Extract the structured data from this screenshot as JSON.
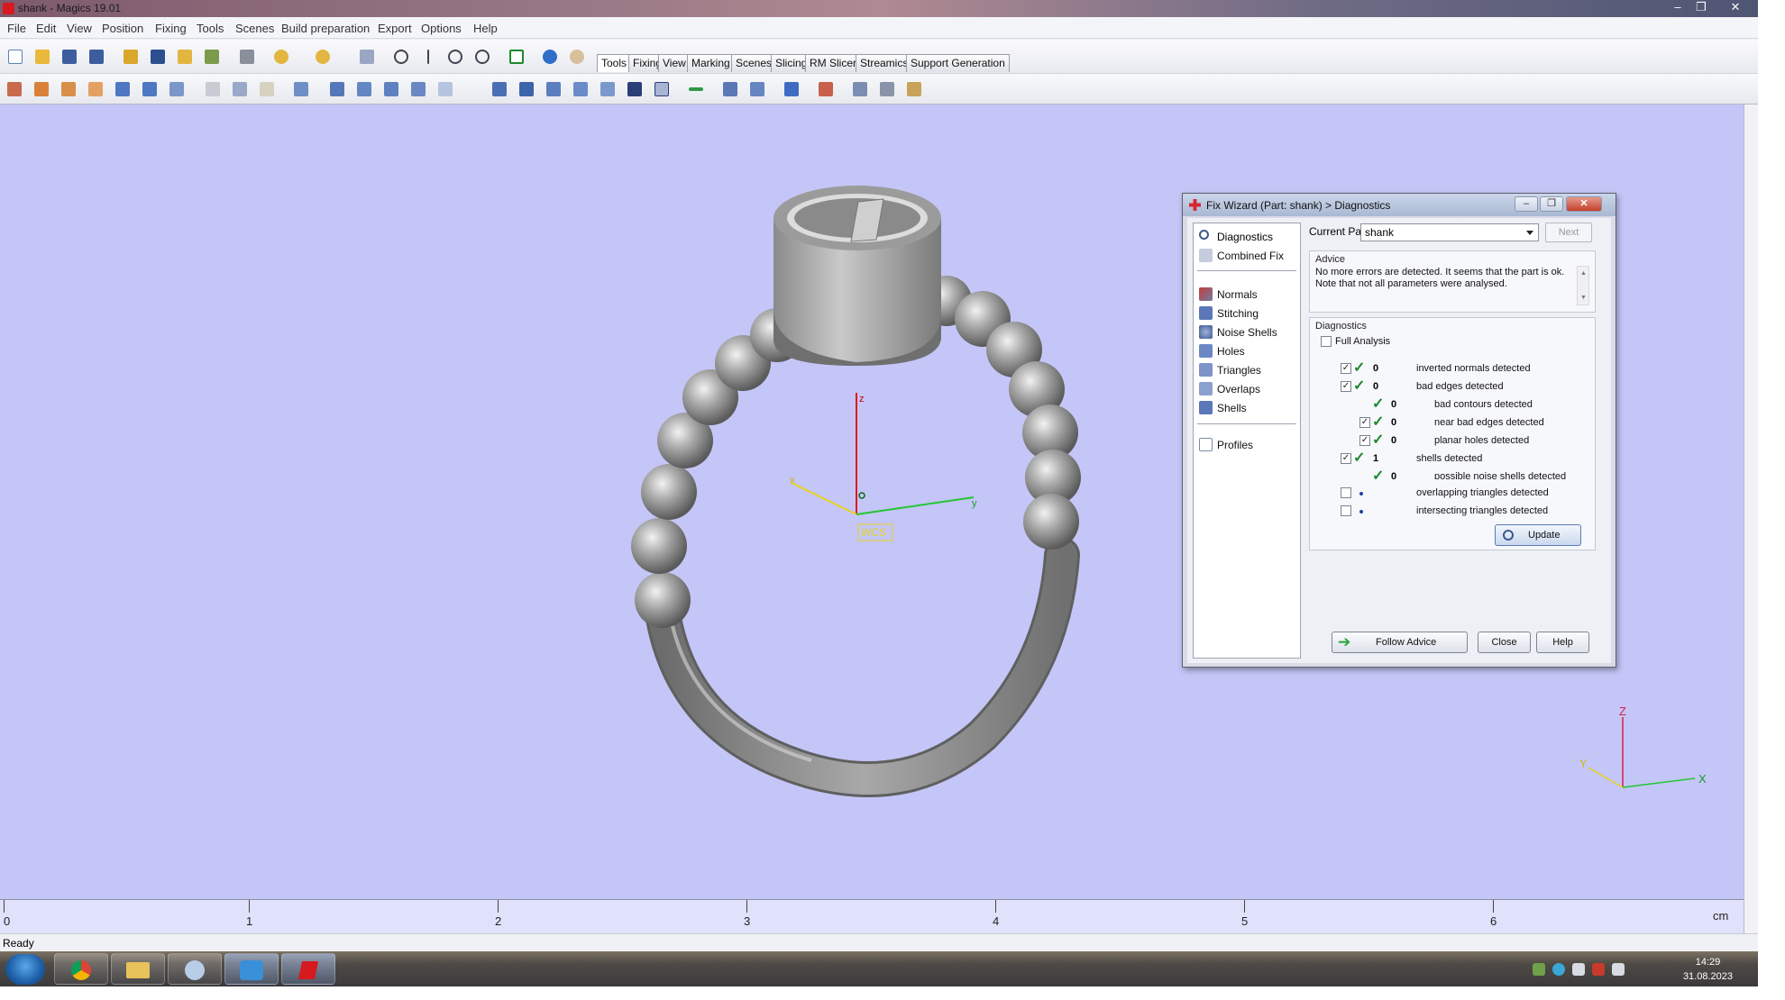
{
  "window": {
    "title": "shank - Magics 19.01",
    "controls": [
      "–",
      "❐",
      "✕"
    ]
  },
  "menu": [
    "File",
    "Edit",
    "View",
    "Position",
    "Fixing",
    "Tools",
    "Scenes",
    "Build preparation",
    "Export",
    "Options",
    "Help"
  ],
  "ribbon_tabs": [
    "Tools",
    "Fixing",
    "View",
    "Marking",
    "Scenes",
    "Slicing",
    "RM Slicer",
    "Streamics",
    "Support Generation"
  ],
  "active_tab": "Tools",
  "viewport": {
    "background": "#c4c6f7",
    "wcs_label": "WCS",
    "axis_labels": {
      "x": "x",
      "y": "y",
      "z": "z"
    },
    "triad_labels": {
      "x": "X",
      "y": "Y",
      "z": "Z"
    }
  },
  "ruler": {
    "unit": "cm",
    "labels": [
      "0",
      "1",
      "2",
      "3",
      "4",
      "5",
      "6"
    ]
  },
  "status": "Ready",
  "taskbar": {
    "time": "14:29",
    "date": "31.08.2023"
  },
  "dialog": {
    "title": "Fix Wizard (Part: shank) > Diagnostics",
    "nav": {
      "top": [
        {
          "label": "Diagnostics",
          "icon": "diagnostics-icon"
        },
        {
          "label": "Combined Fix",
          "icon": "combined-fix-icon"
        }
      ],
      "fixes": [
        {
          "label": "Normals",
          "icon": "normals-icon"
        },
        {
          "label": "Stitching",
          "icon": "stitching-icon"
        },
        {
          "label": "Noise Shells",
          "icon": "noise-shells-icon"
        },
        {
          "label": "Holes",
          "icon": "holes-icon"
        },
        {
          "label": "Triangles",
          "icon": "triangles-icon"
        },
        {
          "label": "Overlaps",
          "icon": "overlaps-icon"
        },
        {
          "label": "Shells",
          "icon": "shells-icon"
        }
      ],
      "bottom": [
        {
          "label": "Profiles",
          "icon": "profiles-icon"
        }
      ]
    },
    "current_part_label": "Current Part:",
    "current_part_value": "shank",
    "next_label": "Next",
    "advice_title": "Advice",
    "advice_text": "No more errors are detected. It seems that the part is ok. Note that not all parameters were analysed.",
    "diagnostics_title": "Diagnostics",
    "full_analysis_label": "Full Analysis",
    "full_analysis_checked": false,
    "checks": [
      {
        "label": "inverted normals detected",
        "count": "0",
        "checked": true,
        "indent": 0,
        "status": "ok"
      },
      {
        "label": "bad edges detected",
        "count": "0",
        "checked": true,
        "indent": 0,
        "status": "ok"
      },
      {
        "label": "bad contours detected",
        "count": "0",
        "checked": null,
        "indent": 1,
        "status": "ok"
      },
      {
        "label": "near bad edges detected",
        "count": "0",
        "checked": true,
        "indent": 1,
        "status": "ok"
      },
      {
        "label": "planar holes detected",
        "count": "0",
        "checked": true,
        "indent": 1,
        "status": "ok"
      },
      {
        "label": "shells detected",
        "count": "1",
        "checked": true,
        "indent": 0,
        "status": "ok"
      },
      {
        "label": "possible noise shells detected",
        "count": "0",
        "checked": null,
        "indent": 1,
        "status": "ok"
      },
      {
        "label": "overlapping triangles detected",
        "count": "",
        "checked": false,
        "indent": 0,
        "status": "not-analysed"
      },
      {
        "label": "intersecting triangles detected",
        "count": "",
        "checked": false,
        "indent": 0,
        "status": "not-analysed"
      }
    ],
    "update_label": "Update",
    "follow_advice_label": "Follow Advice",
    "close_label": "Close",
    "help_label": "Help"
  }
}
